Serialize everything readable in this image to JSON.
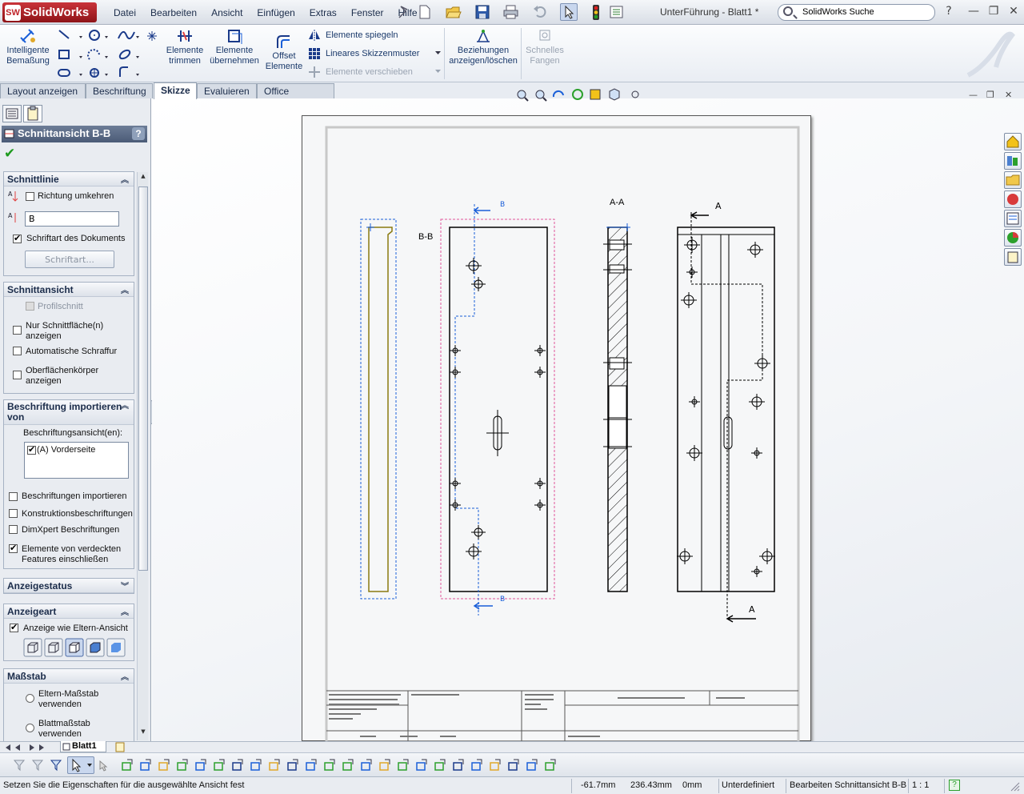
{
  "app": {
    "logo": "SolidWorks",
    "logo_mark": "SW",
    "document_title": "UnterFührung - Blatt1 *"
  },
  "menu": [
    "Datei",
    "Bearbeiten",
    "Ansicht",
    "Einfügen",
    "Extras",
    "Fenster",
    "Hilfe"
  ],
  "search": {
    "placeholder": "SolidWorks Suche"
  },
  "window_buttons": {
    "help": "?",
    "minimize": "—",
    "restore": "❐",
    "close": "✕"
  },
  "commands": {
    "smart_dim": "Intelligente Bemaßung",
    "trim": "Elemente trimmen",
    "convert": "Elemente übernehmen",
    "offset": "Offset Elemente",
    "mirror": "Elemente spiegeln",
    "linear_pattern": "Lineares Skizzenmuster",
    "move": "Elemente verschieben",
    "relations": "Beziehungen anzeigen/löschen",
    "quick_snap": "Schnelles Fangen"
  },
  "tabs": [
    "Layout anzeigen",
    "Beschriftung",
    "Skizze",
    "Evaluieren",
    "Office Produkte"
  ],
  "active_tab": "Skizze",
  "property_manager": {
    "title": "Schnittansicht B-B",
    "help": "?",
    "ok_icon": "✔",
    "groups": {
      "schnittlinie": {
        "title": "Schnittlinie",
        "reverse": "Richtung umkehren",
        "label_value": "B",
        "doc_font": "Schriftart des Dokuments",
        "font_button": "Schriftart..."
      },
      "schnittansicht": {
        "title": "Schnittansicht",
        "profile": "Profilschnitt",
        "surface_only": "Nur Schnittfläche(n) anzeigen",
        "auto_hatch": "Automatische Schraffur",
        "surface_bodies": "Oberflächenkörper anzeigen"
      },
      "import": {
        "title": "Beschriftung importieren von",
        "views_label": "Beschriftungsansicht(en):",
        "view_item": "(A) Vorderseite",
        "import_annot": "Beschriftungen importieren",
        "construction": "Konstruktionsbeschriftungen",
        "dimxpert": "DimXpert Beschriftungen",
        "hidden_features": "Elemente von verdeckten Features einschließen"
      },
      "display_state": {
        "title": "Anzeigestatus"
      },
      "display_style": {
        "title": "Anzeigeart",
        "use_parent": "Anzeige wie Eltern-Ansicht"
      },
      "scale": {
        "title": "Maßstab",
        "parent_scale": "Eltern-Maßstab verwenden",
        "sheet_scale": "Blattmaßstab verwenden"
      }
    }
  },
  "drawing": {
    "view_label_bb": "B-B",
    "view_label_aa": "A-A",
    "arrow_label_b": "B",
    "arrow_label_a": "A"
  },
  "sheet_tab": "Blatt1",
  "status": {
    "message": "Setzen Sie die Eigenschaften für die ausgewählte Ansicht fest",
    "x": "-61.7mm",
    "y": "236.43mm",
    "z": "0mm",
    "state": "Unterdefiniert",
    "mode": "Bearbeiten Schnittansicht B-B",
    "scale": "1 : 1",
    "help": "?"
  },
  "colors": {
    "accent": "#4b5b77",
    "sketch_blue": "#1a5fd8",
    "selection_pink": "#e0559a",
    "olive": "#8a7a10"
  }
}
